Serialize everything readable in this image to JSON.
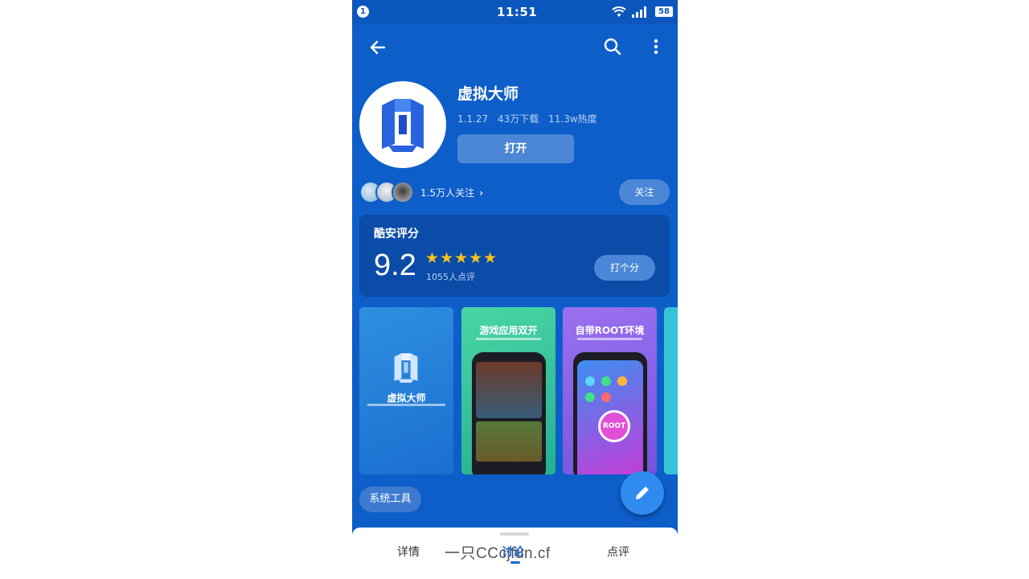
{
  "status_bar": {
    "notification_count": "1",
    "time": "11:51",
    "battery": "58"
  },
  "top_bar": {
    "back_icon": "arrow-left-icon",
    "search_icon": "search-icon",
    "more_icon": "more-vertical-icon"
  },
  "app": {
    "name": "虚拟大师",
    "version": "1.1.27",
    "downloads": "43万下载",
    "popularity": "11.3w热度",
    "open_label": "打开"
  },
  "social": {
    "followers": "1.5万人关注",
    "follow_label": "关注"
  },
  "rating": {
    "title": "酷安评分",
    "score": "9.2",
    "stars": "★★★★★",
    "count": "1055人点评",
    "rate_label": "打个分"
  },
  "screenshots": [
    {
      "title": "虚拟大师"
    },
    {
      "title": "游戏应用双开"
    },
    {
      "title": "自带ROOT环境"
    }
  ],
  "screenshot_root_label": "ROOT",
  "tag": "系统工具",
  "tabs": {
    "details": "详情",
    "discuss": "讨论",
    "reviews": "点评"
  },
  "watermark": "一只CCcjfun.cf",
  "colors": {
    "primary": "#0e5ec9",
    "accent": "#2f8bf0",
    "star": "#f7c31a",
    "active_tab": "#1565d8"
  }
}
